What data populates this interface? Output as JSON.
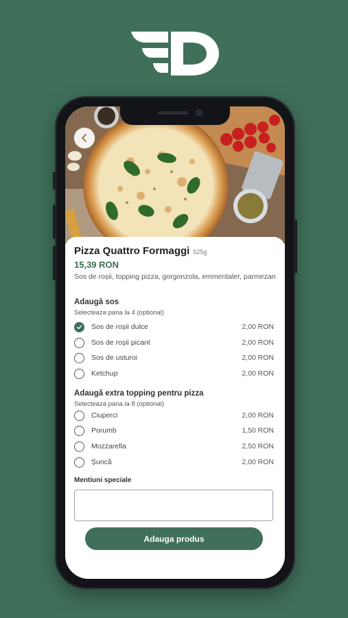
{
  "colors": {
    "brand": "#40705a",
    "price": "#3e6e55"
  },
  "product": {
    "name": "Pizza Quattro Formaggi",
    "weight": "525g",
    "price": "15,39 RON",
    "description": "Sos de roșii, topping pizza, gorgonzola, emmentaler, parmezan"
  },
  "sauces": {
    "title": "Adaugă sos",
    "subtitle": "Selecteaza pana la 4 (optional)",
    "options": [
      {
        "label": "Sos de roșii dulce",
        "price": "2,00 RON",
        "checked": true
      },
      {
        "label": "Sos de roșii picant",
        "price": "2,00 RON",
        "checked": false
      },
      {
        "label": "Sos de usturoi",
        "price": "2,00 RON",
        "checked": false
      },
      {
        "label": "Ketchup",
        "price": "2,00 RON",
        "checked": false
      }
    ]
  },
  "toppings": {
    "title": "Adaugă extra topping pentru pizza",
    "subtitle": "Selecteaza pana la 8 (optional)",
    "options": [
      {
        "label": "Ciuperci",
        "price": "2,00 RON",
        "checked": false
      },
      {
        "label": "Porumb",
        "price": "1,50 RON",
        "checked": false
      },
      {
        "label": "Mozzarella",
        "price": "2,50 RON",
        "checked": false
      },
      {
        "label": "Șuncă",
        "price": "2,00 RON",
        "checked": false
      }
    ]
  },
  "notes": {
    "label": "Mentiuni speciale",
    "value": ""
  },
  "actions": {
    "add_label": "Adauga produs"
  },
  "icons": {
    "logo": "brand-d-logo",
    "back": "chevron-left-icon",
    "check": "check-icon"
  }
}
